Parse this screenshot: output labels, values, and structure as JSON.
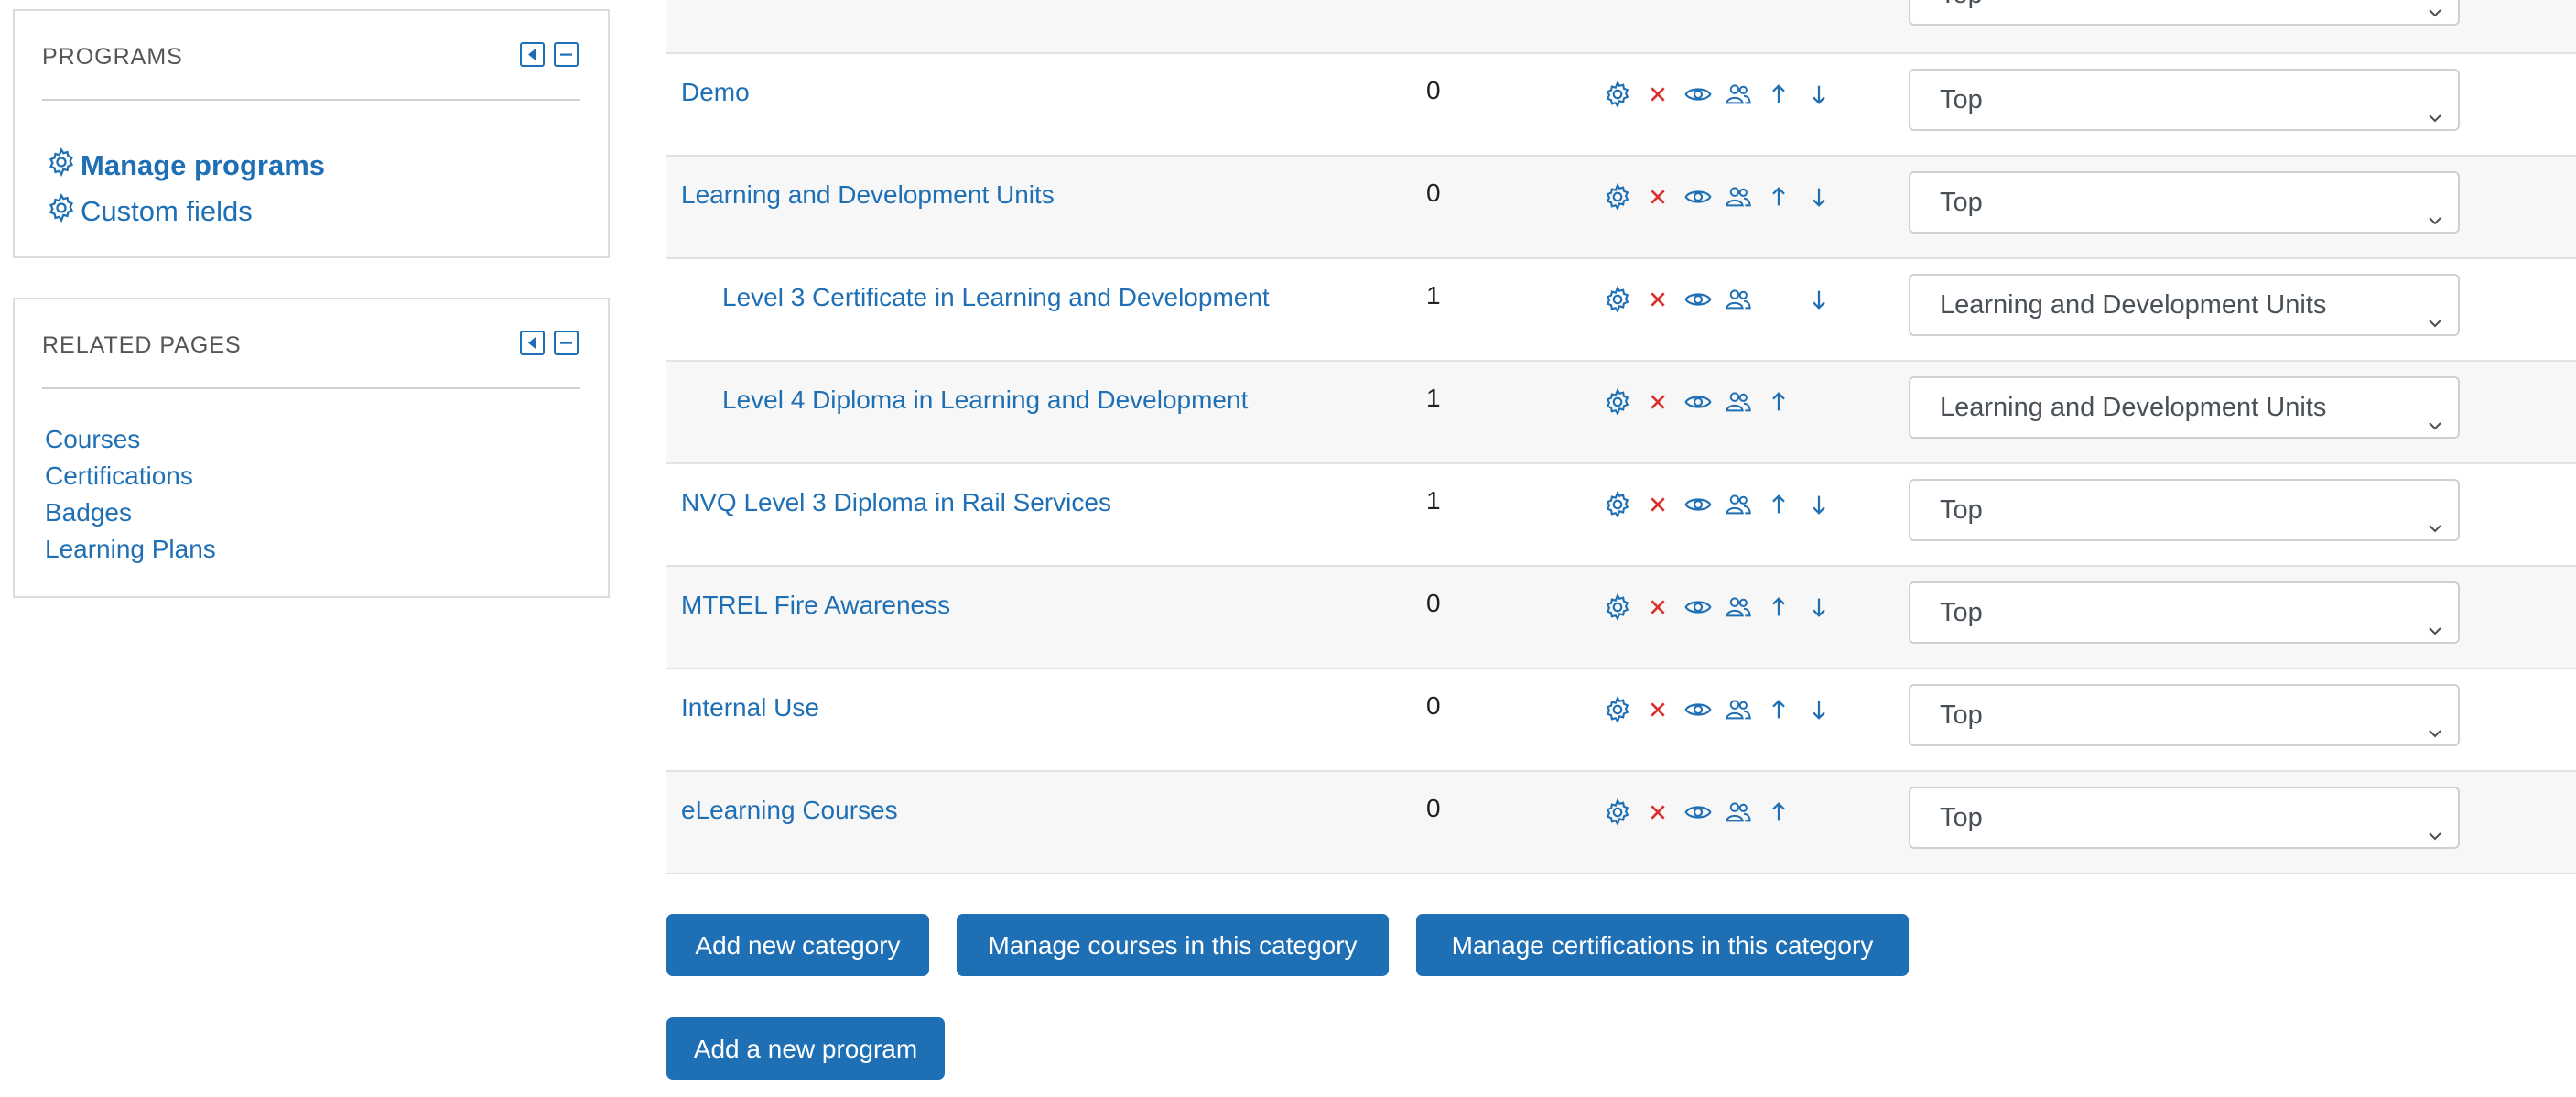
{
  "sidebar": {
    "programs_block": {
      "title": "PROGRAMS",
      "links": [
        {
          "label": "Manage programs",
          "icon": "gear-icon",
          "bold": true
        },
        {
          "label": "Custom fields",
          "icon": "gear-icon",
          "bold": false
        }
      ]
    },
    "related_block": {
      "title": "RELATED PAGES",
      "links": [
        {
          "label": "Courses"
        },
        {
          "label": "Certifications"
        },
        {
          "label": "Badges"
        },
        {
          "label": "Learning Plans"
        }
      ]
    }
  },
  "categories": {
    "partial_top_row": {
      "parent": "Top"
    },
    "rows": [
      {
        "name": "Demo",
        "count": "0",
        "parent": "Top",
        "indent": 0,
        "up": true,
        "down": true
      },
      {
        "name": "Learning and Development Units",
        "count": "0",
        "parent": "Top",
        "indent": 0,
        "up": true,
        "down": true
      },
      {
        "name": "Level 3 Certificate in Learning and Development",
        "count": "1",
        "parent": "Learning and Development Units",
        "indent": 1,
        "up": false,
        "down": true
      },
      {
        "name": "Level 4 Diploma in Learning and Development",
        "count": "1",
        "parent": "Learning and Development Units",
        "indent": 1,
        "up": true,
        "down": false
      },
      {
        "name": "NVQ Level 3 Diploma in Rail Services",
        "count": "1",
        "parent": "Top",
        "indent": 0,
        "up": true,
        "down": true
      },
      {
        "name": "MTREL Fire Awareness",
        "count": "0",
        "parent": "Top",
        "indent": 0,
        "up": true,
        "down": true
      },
      {
        "name": "Internal Use",
        "count": "0",
        "parent": "Top",
        "indent": 0,
        "up": true,
        "down": true
      },
      {
        "name": "eLearning Courses",
        "count": "0",
        "parent": "Top",
        "indent": 0,
        "up": true,
        "down": false
      }
    ]
  },
  "buttons": {
    "add_category": "Add new category",
    "manage_courses": "Manage courses in this category",
    "manage_certifications": "Manage certifications in this category",
    "add_program": "Add a new program"
  },
  "colors": {
    "link": "#1f6fb5",
    "delete": "#d9302c",
    "button_bg": "#1f6fb5",
    "row_alt": "#f7f7f7"
  }
}
